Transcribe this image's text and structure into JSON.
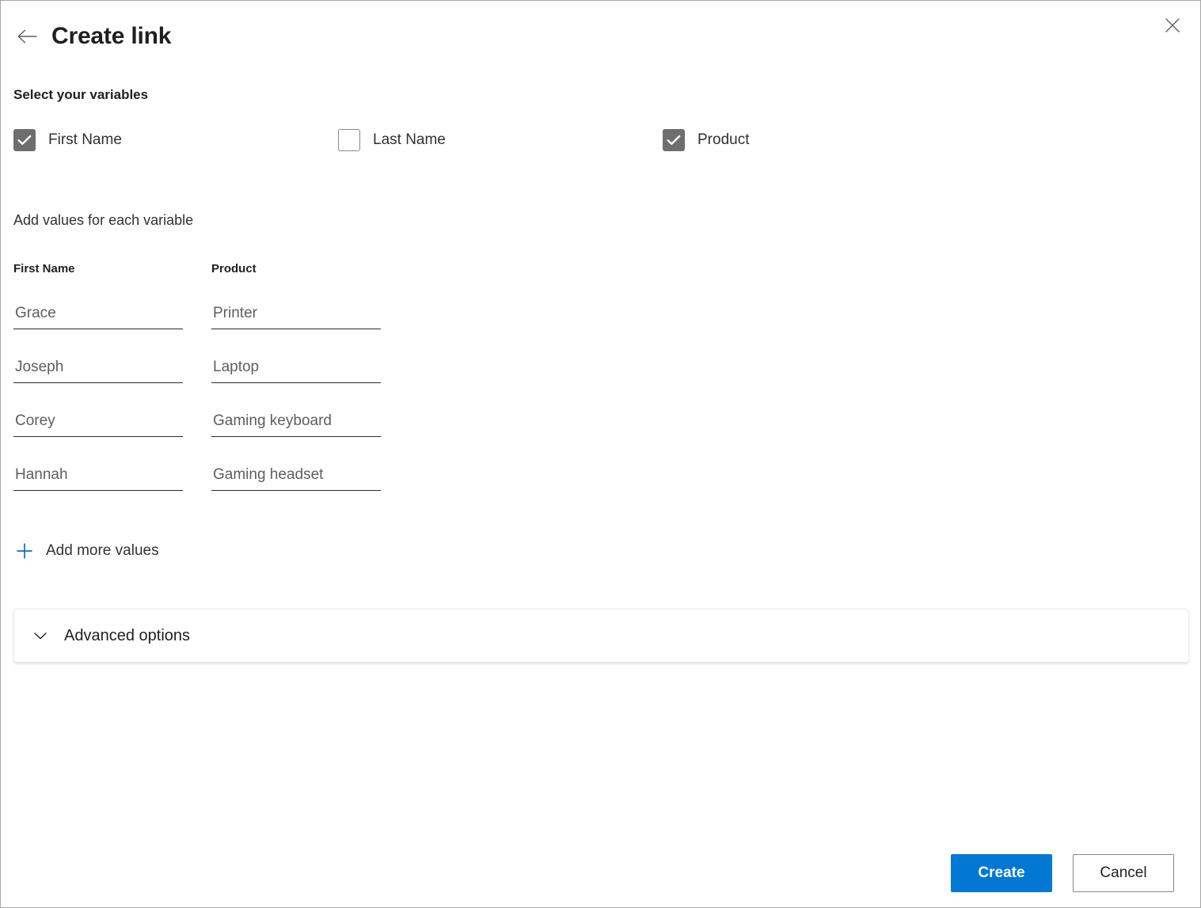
{
  "header": {
    "title": "Create link",
    "back_icon": "arrow-left-icon",
    "close_icon": "close-icon"
  },
  "variables_section": {
    "heading": "Select your variables",
    "checkboxes": [
      {
        "label": "First Name",
        "checked": true
      },
      {
        "label": "Last Name",
        "checked": false
      },
      {
        "label": "Product",
        "checked": true
      }
    ]
  },
  "values_section": {
    "heading": "Add values for each variable",
    "columns": [
      {
        "header": "First Name",
        "values": [
          "Grace",
          "Joseph",
          "Corey",
          "Hannah"
        ]
      },
      {
        "header": "Product",
        "values": [
          "Printer",
          "Laptop",
          "Gaming keyboard",
          "Gaming headset"
        ]
      }
    ],
    "add_more_label": "Add more values",
    "add_more_icon": "plus-icon",
    "add_more_icon_color": "#0f6cbd"
  },
  "advanced": {
    "label": "Advanced options",
    "chevron_icon": "chevron-down-icon",
    "expanded": false
  },
  "footer": {
    "primary_label": "Create",
    "secondary_label": "Cancel",
    "primary_color": "#0078d4"
  }
}
